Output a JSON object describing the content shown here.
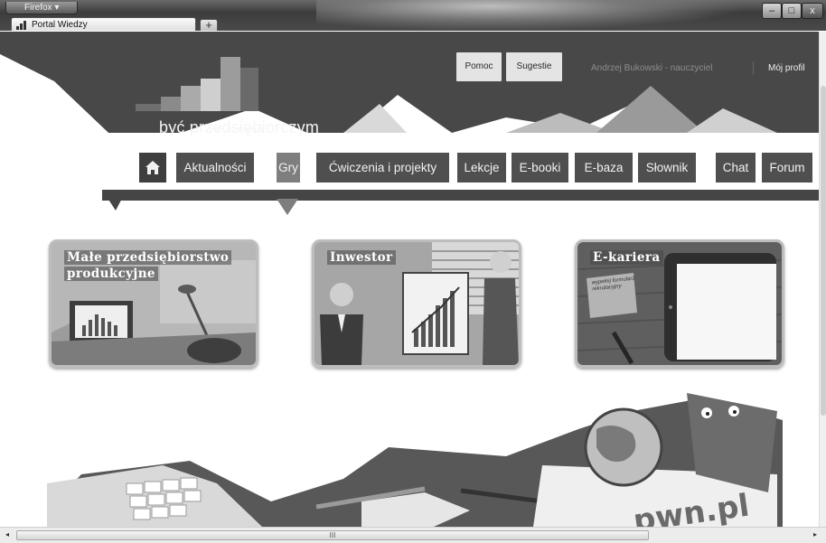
{
  "browser": {
    "menu_button_label": "Firefox ▾",
    "tab_title": "Portal Wiedzy",
    "new_tab_label": "+",
    "window_controls": {
      "minimize": "–",
      "maximize": "□",
      "close": "x"
    }
  },
  "header": {
    "help_label": "Pomoc",
    "suggestions_label": "Sugestie",
    "user_name": "Andrzej Bukowski - nauczyciel",
    "profile_label": "Mój profil",
    "logo_small": "portal wiedzy",
    "logo_big": "być przedsiębiorczym"
  },
  "nav": {
    "home_icon": "home-icon",
    "items": [
      {
        "label": "Aktualności"
      },
      {
        "label": "Gry",
        "active": true
      },
      {
        "label": "Ćwiczenia i projekty"
      },
      {
        "label": "Lekcje"
      },
      {
        "label": "E-booki"
      },
      {
        "label": "E-baza"
      },
      {
        "label": "Słownik"
      },
      {
        "label": "Chat"
      },
      {
        "label": "Forum"
      }
    ]
  },
  "games": [
    {
      "title_line1": "Małe przedsiębiorstwo",
      "title_line2": "produkcyjne"
    },
    {
      "title_line1": "Inwestor",
      "title_line2": ""
    },
    {
      "title_line1": "E-kariera",
      "title_line2": "",
      "note_text": "wypełnij formularz rekrutacyjny"
    }
  ],
  "footer_art": {
    "brand_text": "pwn.pl"
  },
  "scrollbar": {
    "h_thumb_grip": "III",
    "left_arrow": "◂",
    "right_arrow": "▸"
  }
}
